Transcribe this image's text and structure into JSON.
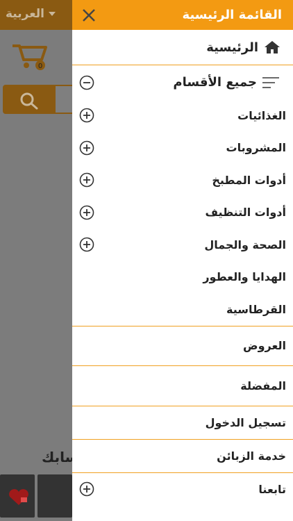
{
  "background": {
    "language_label": "العربية",
    "cart_count": "0",
    "partial_text": "سابك"
  },
  "drawer": {
    "title": "القائمة الرئيسية",
    "home_label": "الرئيسية",
    "categories_label": "جميع الأقسام",
    "subcategories": [
      {
        "label": "الغذائيات",
        "expandable": true
      },
      {
        "label": "المشروبات",
        "expandable": true
      },
      {
        "label": "أدوات المطبخ",
        "expandable": true
      },
      {
        "label": "أدوات التنظيف",
        "expandable": true
      },
      {
        "label": "الصحة والجمال",
        "expandable": true
      },
      {
        "label": "الهدايا والعطور",
        "expandable": false
      },
      {
        "label": "القرطاسية",
        "expandable": false
      }
    ],
    "offers_label": "العروض",
    "favorites_label": "المفضلة",
    "login_label": "تسجيل الدخول",
    "customer_service_label": "خدمة الزبائن",
    "follow_us_label": "تابعنا"
  },
  "colors": {
    "accent": "#f39a12",
    "divider": "#f0a020"
  }
}
